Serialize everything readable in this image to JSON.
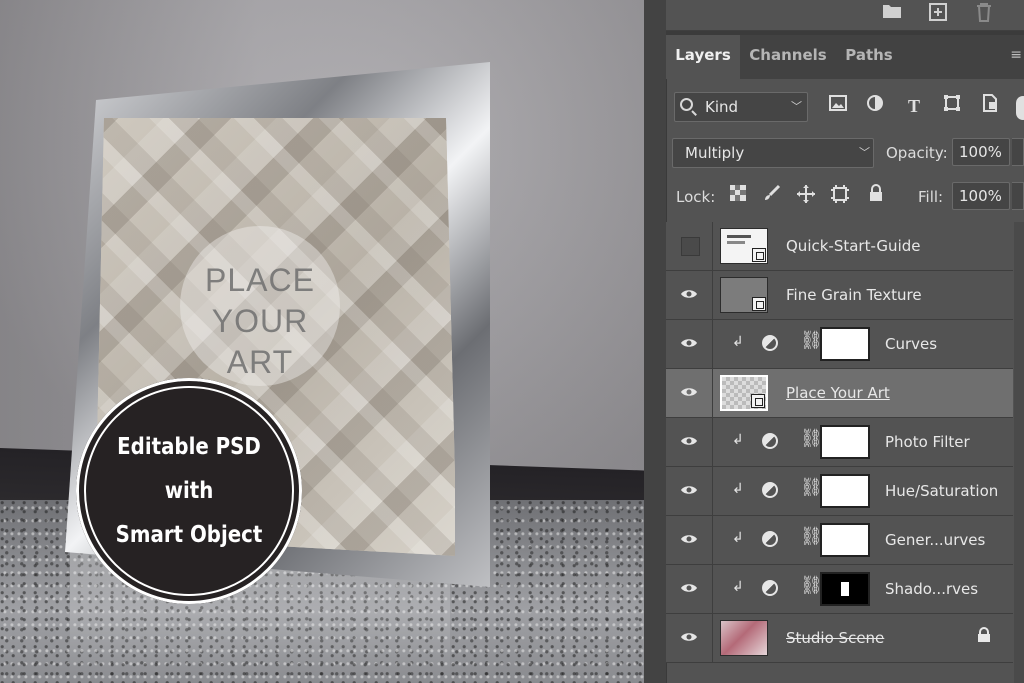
{
  "scene": {
    "artwork_text": [
      "PLACE",
      "YOUR",
      "ART"
    ],
    "badge_lines": [
      "Editable PSD",
      "with",
      "Smart Object"
    ]
  },
  "panel": {
    "top_icons": [
      "folder-icon",
      "new-layer-icon",
      "trash-icon"
    ],
    "tabs": [
      {
        "label": "Layers",
        "active": true
      },
      {
        "label": "Channels",
        "active": false
      },
      {
        "label": "Paths",
        "active": false
      }
    ],
    "filter": {
      "label": "Kind"
    },
    "blend_mode": "Multiply",
    "opacity_label": "Opacity:",
    "opacity_value": "100%",
    "lock_label": "Lock:",
    "fill_label": "Fill:",
    "fill_value": "100%",
    "layers": [
      {
        "name": "Quick-Start-Guide",
        "visible": false,
        "type": "smart-object",
        "selected": false
      },
      {
        "name": "Fine Grain Texture",
        "visible": true,
        "type": "smart-object",
        "selected": false
      },
      {
        "name": "Curves",
        "visible": true,
        "type": "adjustment",
        "selected": false
      },
      {
        "name": "Place Your Art",
        "visible": true,
        "type": "smart-object",
        "selected": true
      },
      {
        "name": "Photo Filter",
        "visible": true,
        "type": "adjustment",
        "selected": false
      },
      {
        "name": "Hue/Saturation",
        "visible": true,
        "type": "adjustment",
        "selected": false
      },
      {
        "name": "Gener...urves",
        "visible": true,
        "type": "adjustment",
        "selected": false
      },
      {
        "name": "Shado...rves",
        "visible": true,
        "type": "adjustment",
        "selected": false
      },
      {
        "name": "Studio Scene",
        "visible": true,
        "type": "background",
        "locked": true,
        "selected": false
      }
    ]
  }
}
